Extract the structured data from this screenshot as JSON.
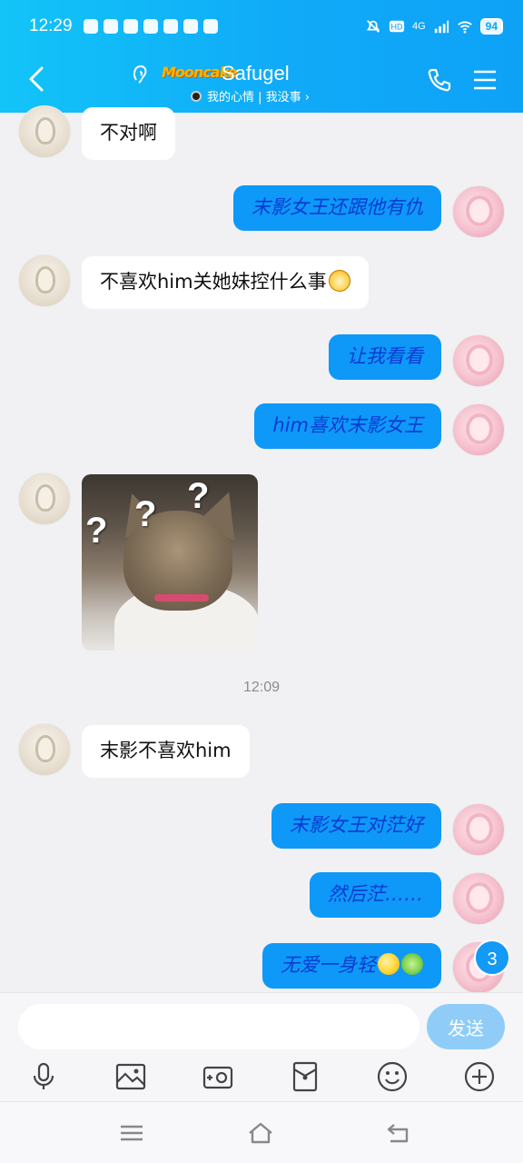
{
  "status_bar": {
    "time": "12:29",
    "network": "4G",
    "battery": "94"
  },
  "header": {
    "title": "Safugel",
    "badge_text": "Mooncake",
    "subtitle": "我的心情 | 我没事 ›"
  },
  "messages": [
    {
      "side": "left",
      "text": "不对啊"
    },
    {
      "side": "right",
      "text": "末影女王还跟他有仇"
    },
    {
      "side": "left",
      "text": "不喜欢him关她妹控什么事",
      "emoji": "dog-face-icon"
    },
    {
      "side": "right",
      "text": "让我看看"
    },
    {
      "side": "right",
      "text": "him喜欢末影女王"
    },
    {
      "side": "left",
      "type": "image",
      "text": "",
      "image_label": "cat-with-question-marks"
    },
    {
      "side": "left",
      "text": "末影不喜欢him"
    },
    {
      "side": "right",
      "text": "末影女王对茫好"
    },
    {
      "side": "right",
      "text": "然后茫……"
    },
    {
      "side": "right",
      "text": "无爱一身轻",
      "emojis": [
        "smile-face-icon",
        "frog-face-icon"
      ]
    }
  ],
  "image_question_marks": [
    "?",
    "?",
    "?"
  ],
  "timestamp": "12:09",
  "unread_count": "3",
  "input": {
    "placeholder": "",
    "value": ""
  },
  "send_button": "发送",
  "toolbar": [
    "microphone-icon",
    "image-icon",
    "camera-icon",
    "red-packet-icon",
    "emoji-icon",
    "plus-icon"
  ],
  "colors": {
    "header": "#10aaf8",
    "bubble_right": "#0e98f8",
    "bubble_right_text": "#0a3bd0",
    "send_button": "#8fcdf8"
  }
}
